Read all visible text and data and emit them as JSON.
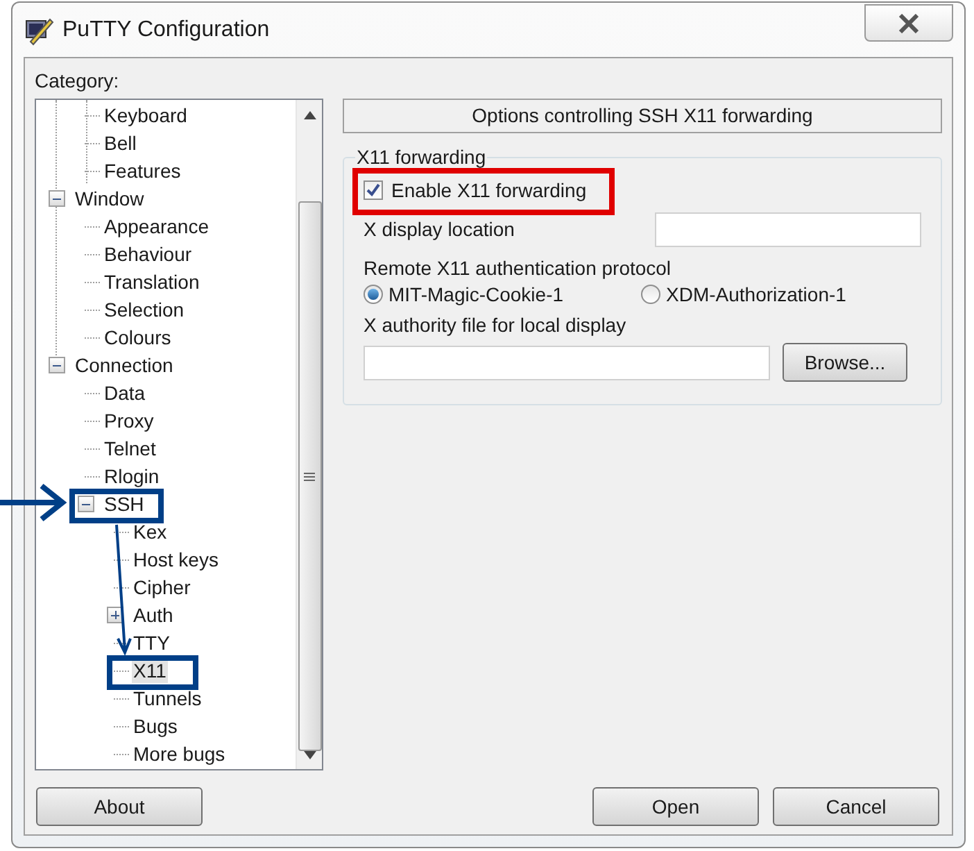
{
  "window": {
    "title": "PuTTY Configuration"
  },
  "category_label": "Category:",
  "tree": {
    "items": [
      {
        "children": [
          {
            "label": "Keyboard",
            "selected": false
          },
          {
            "label": "Bell",
            "selected": false
          },
          {
            "label": "Features",
            "selected": false
          }
        ]
      },
      {
        "label": "Window",
        "selected": false,
        "expanded": true,
        "children": [
          {
            "label": "Appearance",
            "selected": false
          },
          {
            "label": "Behaviour",
            "selected": false
          },
          {
            "label": "Translation",
            "selected": false
          },
          {
            "label": "Selection",
            "selected": false
          },
          {
            "label": "Colours",
            "selected": false
          }
        ]
      },
      {
        "label": "Connection",
        "selected": false,
        "expanded": true,
        "children": [
          {
            "label": "Data",
            "selected": false
          },
          {
            "label": "Proxy",
            "selected": false
          },
          {
            "label": "Telnet",
            "selected": false
          },
          {
            "label": "Rlogin",
            "selected": false
          },
          {
            "label": "SSH",
            "selected": false,
            "expanded": true,
            "children": [
              {
                "label": "Kex",
                "selected": false
              },
              {
                "label": "Host keys",
                "selected": false
              },
              {
                "label": "Cipher",
                "selected": false
              },
              {
                "label": "Auth",
                "selected": false,
                "expanded": false
              },
              {
                "label": "TTY",
                "selected": false
              },
              {
                "label": "X11",
                "selected": true
              },
              {
                "label": "Tunnels",
                "selected": false
              },
              {
                "label": "Bugs",
                "selected": false
              },
              {
                "label": "More bugs",
                "selected": false
              }
            ]
          }
        ]
      }
    ]
  },
  "panel": {
    "heading": "Options controlling SSH X11 forwarding",
    "group": {
      "title": "X11 forwarding",
      "enable": {
        "label": "Enable X11 forwarding",
        "checked": true
      },
      "display_location": {
        "label": "X display location"
      },
      "auth_protocol": {
        "label": "Remote X11 authentication protocol",
        "options": [
          {
            "label": "MIT-Magic-Cookie-1",
            "selected": true
          },
          {
            "label": "XDM-Authorization-1",
            "selected": false
          }
        ]
      },
      "authority_file": {
        "label": "X authority file for local display",
        "button": "Browse..."
      }
    }
  },
  "buttons": {
    "about": "About",
    "open": "Open",
    "cancel": "Cancel"
  }
}
